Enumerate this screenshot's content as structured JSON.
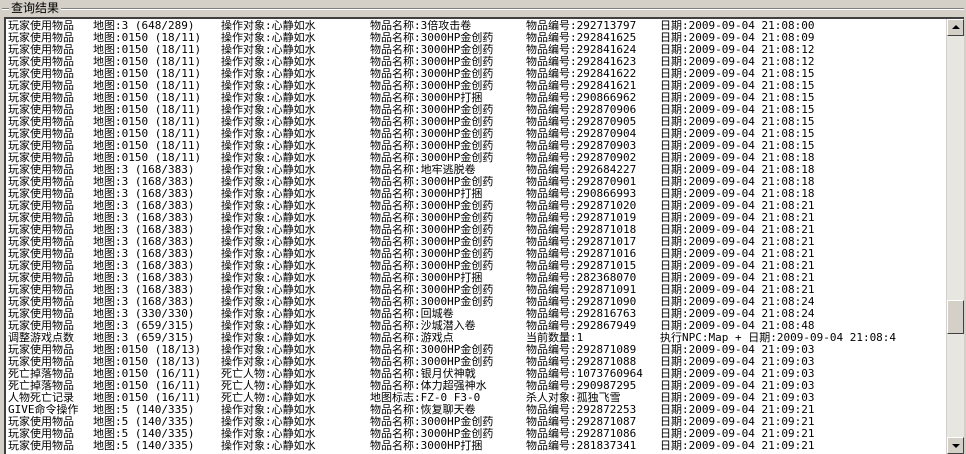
{
  "groupbox": {
    "title": "查询结果"
  },
  "scrollbar": {
    "position_fraction": 0.72
  },
  "rows": [
    [
      "玩家使用物品",
      "地图:3 (648/289)",
      "操作对象:心静如水",
      "物品名称:3倍攻击卷",
      "物品编号:292713797",
      "日期:2009-09-04 21:08:00"
    ],
    [
      "玩家使用物品",
      "地图:0150 (18/11)",
      "操作对象:心静如水",
      "物品名称:3000HP金创药",
      "物品编号:292841625",
      "日期:2009-09-04 21:08:09"
    ],
    [
      "玩家使用物品",
      "地图:0150 (18/11)",
      "操作对象:心静如水",
      "物品名称:3000HP金创药",
      "物品编号:292841624",
      "日期:2009-09-04 21:08:12"
    ],
    [
      "玩家使用物品",
      "地图:0150 (18/11)",
      "操作对象:心静如水",
      "物品名称:3000HP金创药",
      "物品编号:292841623",
      "日期:2009-09-04 21:08:12"
    ],
    [
      "玩家使用物品",
      "地图:0150 (18/11)",
      "操作对象:心静如水",
      "物品名称:3000HP金创药",
      "物品编号:292841622",
      "日期:2009-09-04 21:08:15"
    ],
    [
      "玩家使用物品",
      "地图:0150 (18/11)",
      "操作对象:心静如水",
      "物品名称:3000HP金创药",
      "物品编号:292841621",
      "日期:2009-09-04 21:08:15"
    ],
    [
      "玩家使用物品",
      "地图:0150 (18/11)",
      "操作对象:心静如水",
      "物品名称:3000HP打捆",
      "物品编号:290866962",
      "日期:2009-09-04 21:08:15"
    ],
    [
      "玩家使用物品",
      "地图:0150 (18/11)",
      "操作对象:心静如水",
      "物品名称:3000HP金创药",
      "物品编号:292870906",
      "日期:2009-09-04 21:08:15"
    ],
    [
      "玩家使用物品",
      "地图:0150 (18/11)",
      "操作对象:心静如水",
      "物品名称:3000HP金创药",
      "物品编号:292870905",
      "日期:2009-09-04 21:08:15"
    ],
    [
      "玩家使用物品",
      "地图:0150 (18/11)",
      "操作对象:心静如水",
      "物品名称:3000HP金创药",
      "物品编号:292870904",
      "日期:2009-09-04 21:08:15"
    ],
    [
      "玩家使用物品",
      "地图:0150 (18/11)",
      "操作对象:心静如水",
      "物品名称:3000HP金创药",
      "物品编号:292870903",
      "日期:2009-09-04 21:08:15"
    ],
    [
      "玩家使用物品",
      "地图:0150 (18/11)",
      "操作对象:心静如水",
      "物品名称:3000HP金创药",
      "物品编号:292870902",
      "日期:2009-09-04 21:08:18"
    ],
    [
      "玩家使用物品",
      "地图:3 (168/383)",
      "操作对象:心静如水",
      "物品名称:地牢逃脱卷",
      "物品编号:292684227",
      "日期:2009-09-04 21:08:18"
    ],
    [
      "玩家使用物品",
      "地图:3 (168/383)",
      "操作对象:心静如水",
      "物品名称:3000HP金创药",
      "物品编号:292870901",
      "日期:2009-09-04 21:08:18"
    ],
    [
      "玩家使用物品",
      "地图:3 (168/383)",
      "操作对象:心静如水",
      "物品名称:3000HP打捆",
      "物品编号:290866993",
      "日期:2009-09-04 21:08:18"
    ],
    [
      "玩家使用物品",
      "地图:3 (168/383)",
      "操作对象:心静如水",
      "物品名称:3000HP金创药",
      "物品编号:292871020",
      "日期:2009-09-04 21:08:21"
    ],
    [
      "玩家使用物品",
      "地图:3 (168/383)",
      "操作对象:心静如水",
      "物品名称:3000HP金创药",
      "物品编号:292871019",
      "日期:2009-09-04 21:08:21"
    ],
    [
      "玩家使用物品",
      "地图:3 (168/383)",
      "操作对象:心静如水",
      "物品名称:3000HP金创药",
      "物品编号:292871018",
      "日期:2009-09-04 21:08:21"
    ],
    [
      "玩家使用物品",
      "地图:3 (168/383)",
      "操作对象:心静如水",
      "物品名称:3000HP金创药",
      "物品编号:292871017",
      "日期:2009-09-04 21:08:21"
    ],
    [
      "玩家使用物品",
      "地图:3 (168/383)",
      "操作对象:心静如水",
      "物品名称:3000HP金创药",
      "物品编号:292871016",
      "日期:2009-09-04 21:08:21"
    ],
    [
      "玩家使用物品",
      "地图:3 (168/383)",
      "操作对象:心静如水",
      "物品名称:3000HP金创药",
      "物品编号:292871015",
      "日期:2009-09-04 21:08:21"
    ],
    [
      "玩家使用物品",
      "地图:3 (168/383)",
      "操作对象:心静如水",
      "物品名称:3000HP打捆",
      "物品编号:282368070",
      "日期:2009-09-04 21:08:21"
    ],
    [
      "玩家使用物品",
      "地图:3 (168/383)",
      "操作对象:心静如水",
      "物品名称:3000HP金创药",
      "物品编号:292871091",
      "日期:2009-09-04 21:08:21"
    ],
    [
      "玩家使用物品",
      "地图:3 (168/383)",
      "操作对象:心静如水",
      "物品名称:3000HP金创药",
      "物品编号:292871090",
      "日期:2009-09-04 21:08:24"
    ],
    [
      "玩家使用物品",
      "地图:3 (330/330)",
      "操作对象:心静如水",
      "物品名称:回城卷",
      "物品编号:292816763",
      "日期:2009-09-04 21:08:24"
    ],
    [
      "玩家使用物品",
      "地图:3 (659/315)",
      "操作对象:心静如水",
      "物品名称:沙城潜入卷",
      "物品编号:292867949",
      "日期:2009-09-04 21:08:48"
    ],
    [
      "调整游戏点数",
      "地图:3 (659/315)",
      "操作对象:心静如水",
      "物品名称:游戏点",
      "当前数量:1",
      "执行NPC:Map     + 日期:2009-09-04 21:08:4"
    ],
    [
      "玩家使用物品",
      "地图:0150 (18/13)",
      "操作对象:心静如水",
      "物品名称:3000HP金创药",
      "物品编号:292871089",
      "日期:2009-09-04 21:09:03"
    ],
    [
      "玩家使用物品",
      "地图:0150 (18/13)",
      "操作对象:心静如水",
      "物品名称:3000HP金创药",
      "物品编号:292871088",
      "日期:2009-09-04 21:09:03"
    ],
    [
      "死亡掉落物品",
      "地图:0150 (16/11)",
      "死亡人物:心静如水",
      "物品名称:银月伏神戟",
      "物品编号:1073760964",
      "日期:2009-09-04 21:09:03"
    ],
    [
      "死亡掉落物品",
      "地图:0150 (16/11)",
      "死亡人物:心静如水",
      "物品名称:体力超强神水",
      "物品编号:290987295",
      "日期:2009-09-04 21:09:03"
    ],
    [
      "人物死亡记录",
      "地图:0150 (16/11)",
      "死亡人物:心静如水",
      "地图标志:FZ-0 F3-0",
      "杀人对象:孤独飞雪",
      "日期:2009-09-04 21:09:03"
    ],
    [
      "GIVE命令操作",
      "地图:5 (140/335)",
      "操作对象:心静如水",
      "物品名称:恢复聊天卷",
      "物品编号:292872253",
      "日期:2009-09-04 21:09:21"
    ],
    [
      "玩家使用物品",
      "地图:5 (140/335)",
      "操作对象:心静如水",
      "物品名称:3000HP金创药",
      "物品编号:292871087",
      "日期:2009-09-04 21:09:21"
    ],
    [
      "玩家使用物品",
      "地图:5 (140/335)",
      "操作对象:心静如水",
      "物品名称:3000HP金创药",
      "物品编号:292871086",
      "日期:2009-09-04 21:09:21"
    ],
    [
      "玩家使用物品",
      "地图:5 (140/335)",
      "操作对象:心静如水",
      "物品名称:3000HP打捆",
      "物品编号:281837341",
      "日期:2009-09-04 21:09:21"
    ]
  ]
}
